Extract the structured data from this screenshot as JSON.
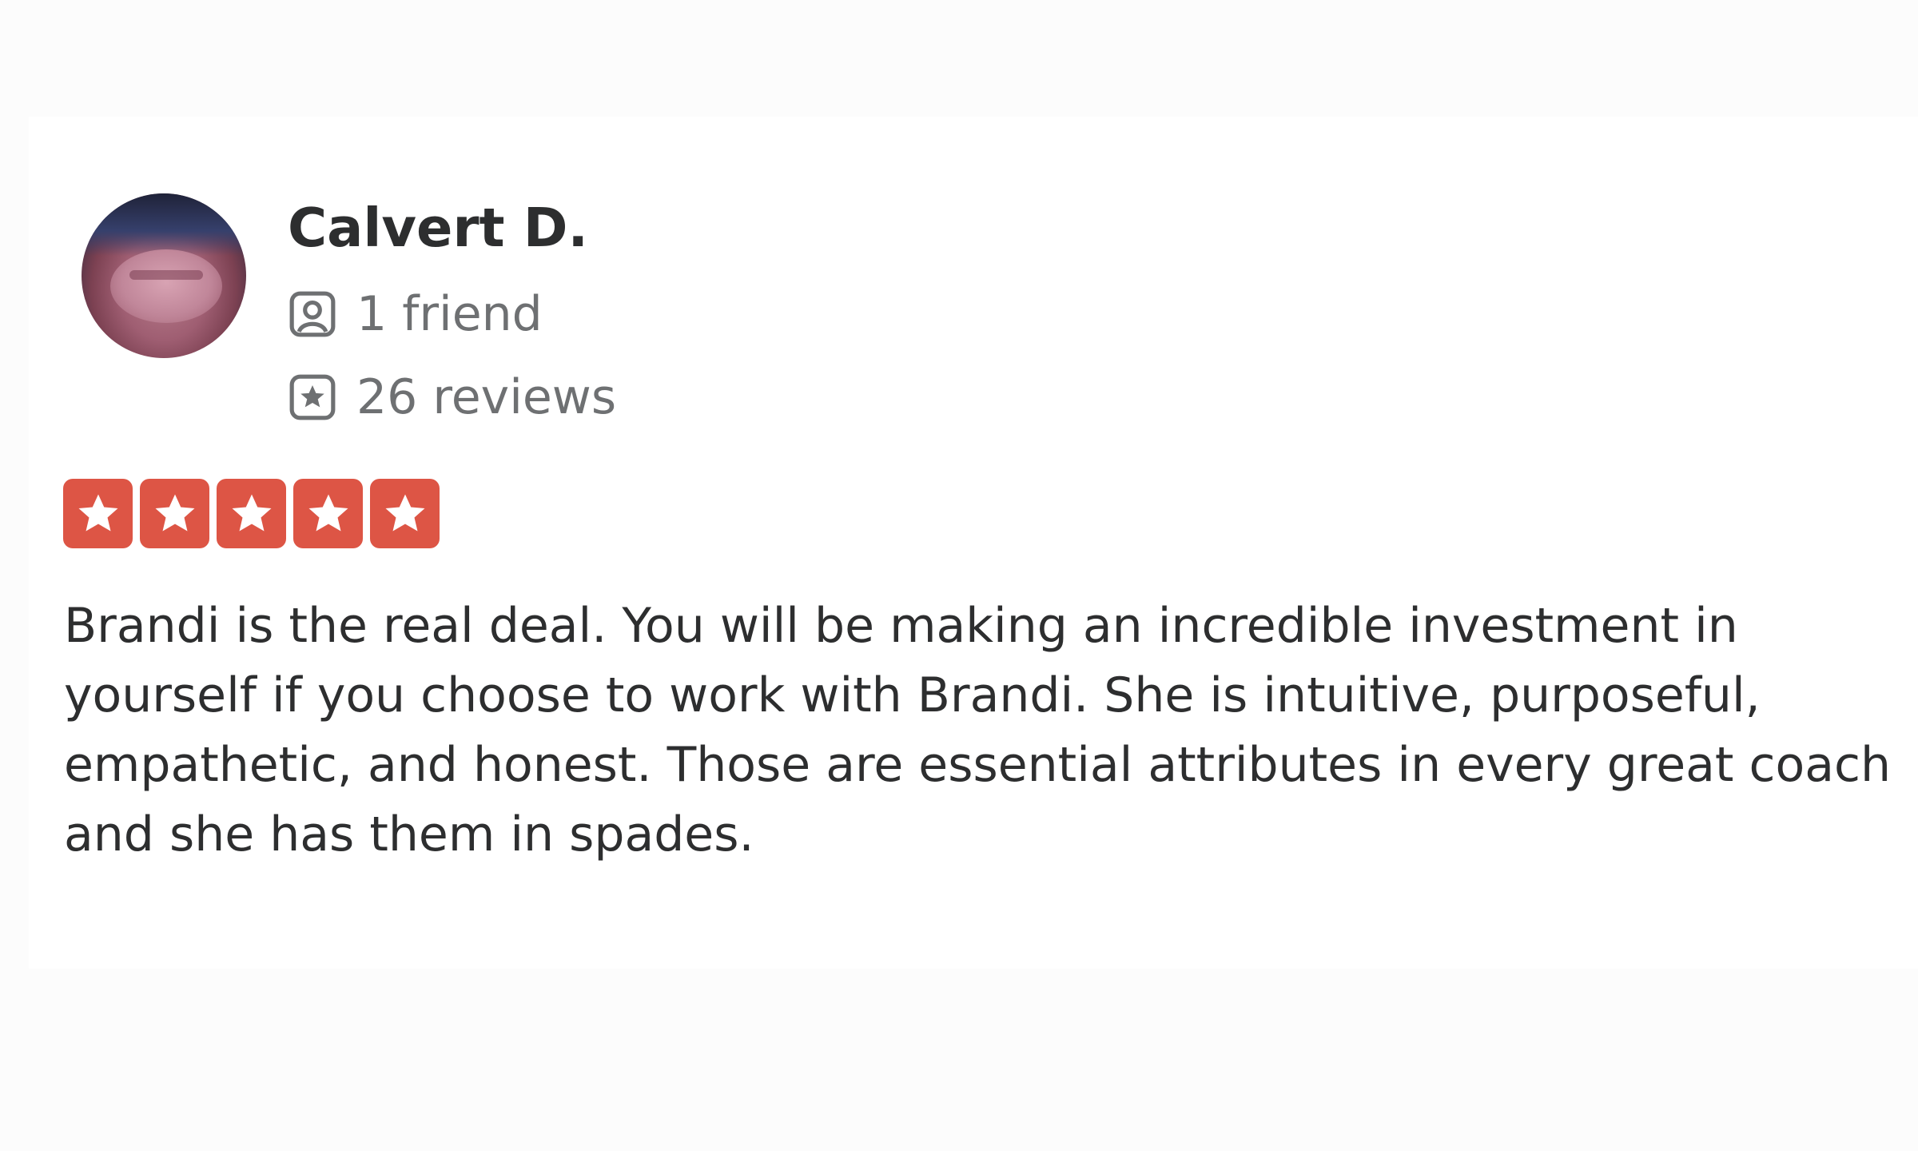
{
  "review": {
    "user": {
      "name": "Calvert D.",
      "friends": "1 friend",
      "reviews": "26 reviews"
    },
    "rating": 5,
    "rating_max": 5,
    "text": "Brandi is the real deal. You will be making an incredible investment in yourself if you choose to work with Brandi. She is intuitive, purposeful, empathetic, and honest. Those are essential attributes in every great coach and she has them in spades."
  },
  "icons": {
    "friends": "friend-icon",
    "reviews": "review-star-icon",
    "rating": "star-icon"
  },
  "colors": {
    "star_background": "#dd5545",
    "name_text": "#2d2e2f",
    "meta_text": "#6e7072",
    "body_text": "#2d2e2f"
  }
}
